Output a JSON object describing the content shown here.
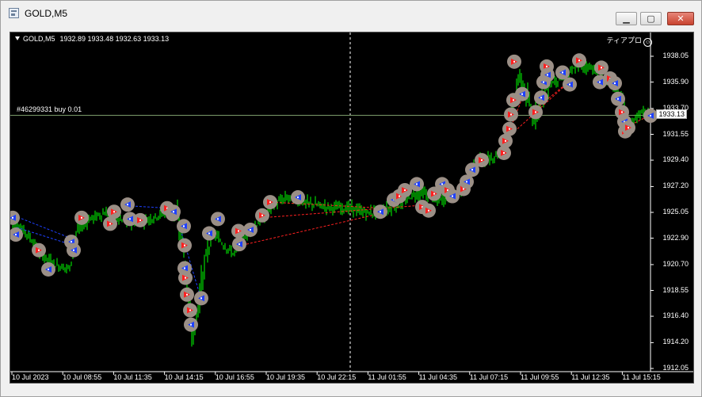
{
  "window": {
    "title": "GOLD,M5",
    "buttons": [
      "minimize",
      "maximize",
      "close"
    ]
  },
  "chart": {
    "symbol": "GOLD,M5",
    "ohlc": "1932.89 1933.48 1932.63 1933.13",
    "ea_label": "ティアプロ",
    "order_label": "#46299331 buy 0.01",
    "current_price": "1933.13",
    "price_labels": [
      "1938.05",
      "1935.90",
      "1933.70",
      "1931.55",
      "1929.40",
      "1927.20",
      "1925.05",
      "1922.90",
      "1920.70",
      "1918.55",
      "1916.40",
      "1914.20",
      "1912.05"
    ],
    "time_labels": [
      "10 Jul 2023",
      "10 Jul 08:55",
      "10 Jul 11:35",
      "10 Jul 14:15",
      "10 Jul 16:55",
      "10 Jul 19:35",
      "10 Jul 22:15",
      "11 Jul 01:55",
      "11 Jul 04:35",
      "11 Jul 07:15",
      "11 Jul 09:55",
      "11 Jul 12:35",
      "11 Jul 15:15"
    ],
    "colors": {
      "background": "#000000",
      "bull": "#00ff00",
      "bear": "#00ff00",
      "buy": "#1e40ff",
      "sell": "#ff2020",
      "trade_line": "#ff2020",
      "marker_halo": "#9b8f86"
    },
    "ylim": [
      1912.05,
      1938.6
    ]
  }
}
